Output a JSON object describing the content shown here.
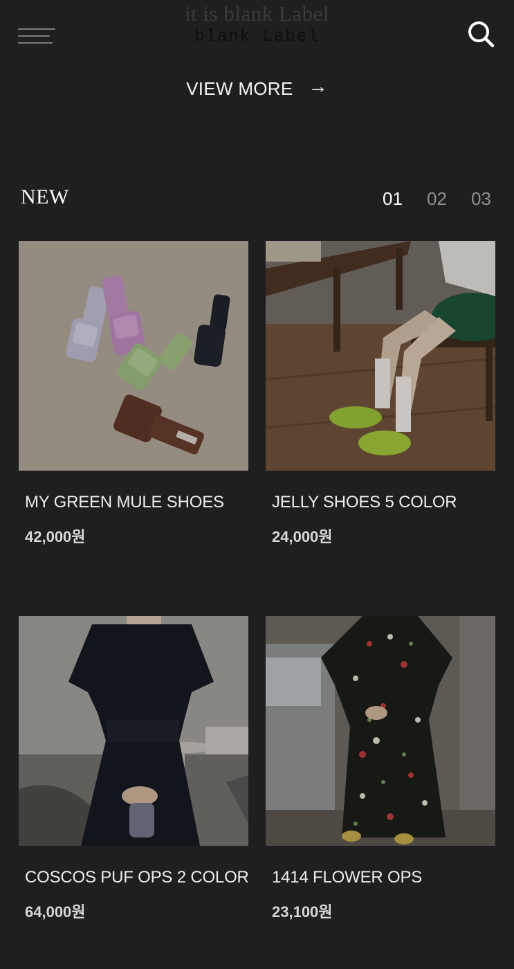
{
  "header": {
    "ghost_title": "it is blank Label",
    "logo": "blank Label",
    "menu_icon": "hamburger-menu-icon",
    "search_icon": "search-icon"
  },
  "view_more": {
    "label": "VIEW MORE",
    "arrow": "→"
  },
  "section": {
    "title": "NEW",
    "pages": [
      "01",
      "02",
      "03"
    ],
    "active_page": "01"
  },
  "products": [
    {
      "name": "MY GREEN MULE SHOES",
      "price": "42,000원"
    },
    {
      "name": "JELLY SHOES 5 COLOR",
      "price": "24,000원"
    },
    {
      "name": "COSCOS PUF OPS 2 COLOR",
      "price": "64,000원"
    },
    {
      "name": "1414 FLOWER OPS",
      "price": "23,100원"
    }
  ],
  "colors": {
    "background": "#1f1f21",
    "text": "#f2f2f2",
    "pager_inactive": "#8e8e8e"
  }
}
